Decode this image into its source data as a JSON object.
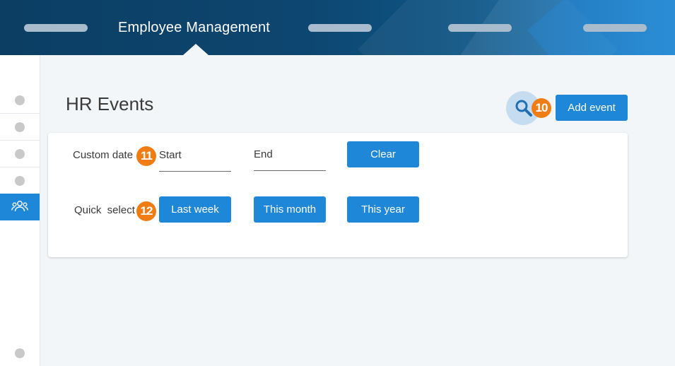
{
  "header": {
    "title": "Employee Management"
  },
  "page": {
    "title": "HR Events",
    "add_button_label": "Add event",
    "search_badge": "10"
  },
  "filters": {
    "custom_date": {
      "label": "Custom date",
      "badge": "11",
      "start_placeholder": "Start",
      "end_placeholder": "End",
      "clear_label": "Clear"
    },
    "quick_select": {
      "label": "Quick  select",
      "badge": "12",
      "options": [
        "Last week",
        "This month",
        "This year"
      ]
    }
  },
  "sidebar": {
    "active_icon": "people-icon"
  },
  "colors": {
    "primary": "#1f87d8",
    "badge": "#f07d14",
    "header_dark": "#0c3e63"
  }
}
